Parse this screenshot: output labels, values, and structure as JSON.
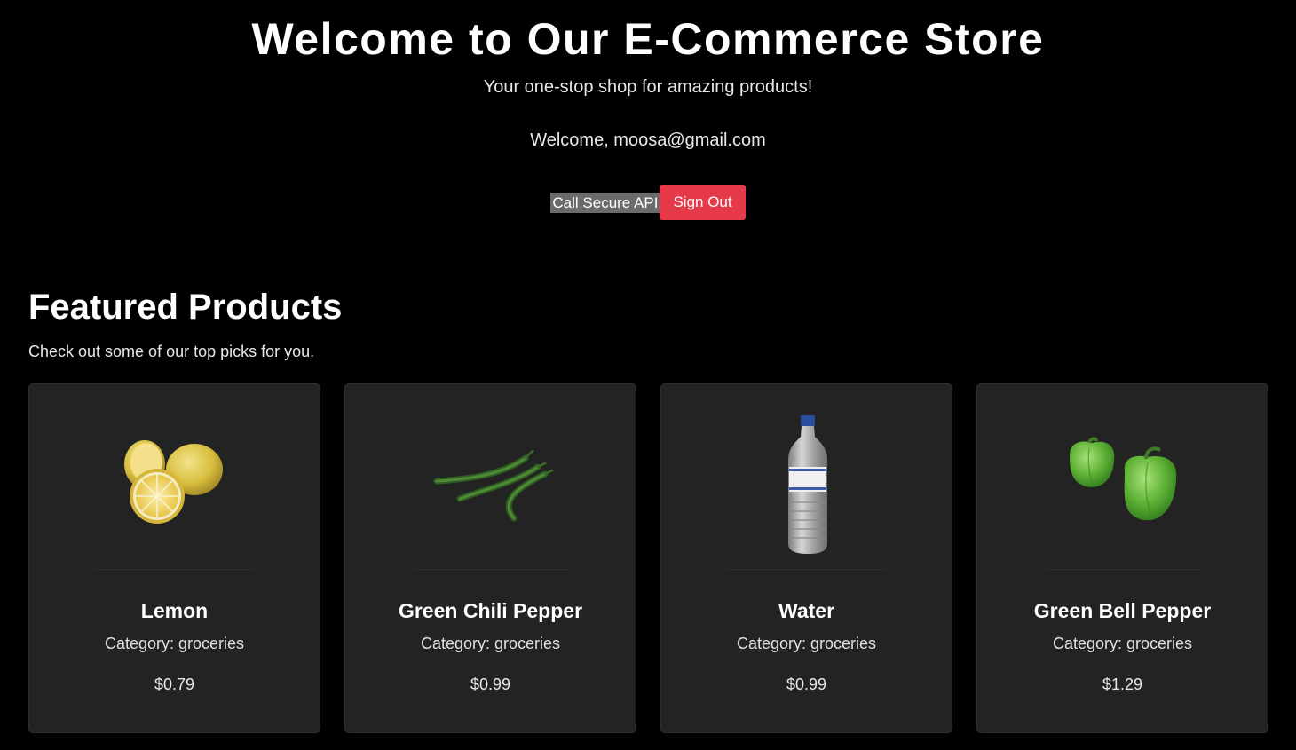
{
  "header": {
    "title": "Welcome to Our E-Commerce Store",
    "subtitle": "Your one-stop shop for amazing products!",
    "welcome": "Welcome, moosa@gmail.com",
    "call_api_label": "Call Secure API",
    "sign_out_label": "Sign Out"
  },
  "featured": {
    "title": "Featured Products",
    "description": "Check out some of our top picks for you.",
    "products": [
      {
        "name": "Lemon",
        "category": "Category: groceries",
        "price": "$0.79",
        "image": "lemon-image"
      },
      {
        "name": "Green Chili Pepper",
        "category": "Category: groceries",
        "price": "$0.99",
        "image": "green-chili-pepper-image"
      },
      {
        "name": "Water",
        "category": "Category: groceries",
        "price": "$0.99",
        "image": "water-bottle-image"
      },
      {
        "name": "Green Bell Pepper",
        "category": "Category: groceries",
        "price": "$1.29",
        "image": "green-bell-pepper-image"
      }
    ]
  },
  "colors": {
    "background": "#000000",
    "card_background": "#232323",
    "sign_out_button": "#e6394a",
    "api_button": "#6b6b6b"
  }
}
